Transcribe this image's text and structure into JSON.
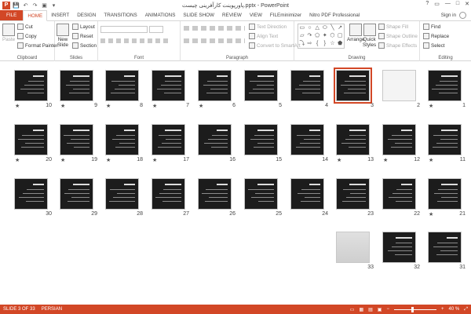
{
  "window": {
    "title": "پاورپوینت کارآفرینی چیست.pptx - PowerPoint",
    "app_icon": "P",
    "controls": {
      "help": "?",
      "restore": "▭",
      "minimize": "—",
      "maximize": "□",
      "close": "✕"
    }
  },
  "qat": {
    "save": "💾",
    "undo": "↶",
    "redo": "↷",
    "present": "▣",
    "customize": "▾"
  },
  "tabs": [
    {
      "label": "FILE"
    },
    {
      "label": "HOME"
    },
    {
      "label": "INSERT"
    },
    {
      "label": "DESIGN"
    },
    {
      "label": "TRANSITIONS"
    },
    {
      "label": "ANIMATIONS"
    },
    {
      "label": "SLIDE SHOW"
    },
    {
      "label": "REVIEW"
    },
    {
      "label": "VIEW"
    },
    {
      "label": "FILEminimizer"
    },
    {
      "label": "Nitro PDF Professional"
    }
  ],
  "account": {
    "signin": "Sign in"
  },
  "ribbon": {
    "clipboard": {
      "label": "Clipboard",
      "paste": "Paste",
      "cut": "Cut",
      "copy": "Copy",
      "format_painter": "Format Painter"
    },
    "slides": {
      "label": "Slides",
      "new_slide": "New",
      "new_slide2": "Slide",
      "layout": "Layout",
      "reset": "Reset",
      "section": "Section"
    },
    "font": {
      "label": "Font"
    },
    "paragraph": {
      "label": "Paragraph",
      "text_direction": "Text Direction",
      "align_text": "Align Text",
      "smartart": "Convert to SmartArt"
    },
    "drawing": {
      "label": "Drawing",
      "arrange": "Arrange",
      "quick_styles": "Quick",
      "quick_styles2": "Styles",
      "shape_fill": "Shape Fill",
      "shape_outline": "Shape Outline",
      "shape_effects": "Shape Effects"
    },
    "editing": {
      "label": "Editing",
      "find": "Find",
      "replace": "Replace",
      "select": "Select"
    },
    "shape_glyphs": [
      "▭",
      "○",
      "△",
      "⬭",
      "╲",
      "↗",
      "▱",
      "↷",
      "⬠",
      "✦",
      "⬡",
      "▢",
      "⤵",
      "⇨",
      "{",
      "}",
      "☆",
      "⬟"
    ]
  },
  "slides": [
    {
      "n": "10",
      "star": "★"
    },
    {
      "n": "9",
      "star": "★"
    },
    {
      "n": "8",
      "star": "★"
    },
    {
      "n": "7",
      "star": "★"
    },
    {
      "n": "6",
      "star": "★"
    },
    {
      "n": "5",
      "star": ""
    },
    {
      "n": "4",
      "star": ""
    },
    {
      "n": "3",
      "star": ""
    },
    {
      "n": "2",
      "star": ""
    },
    {
      "n": "1",
      "star": "★"
    },
    {
      "n": "20",
      "star": "★"
    },
    {
      "n": "19",
      "star": "★"
    },
    {
      "n": "18",
      "star": "★"
    },
    {
      "n": "17",
      "star": "★"
    },
    {
      "n": "16",
      "star": ""
    },
    {
      "n": "15",
      "star": ""
    },
    {
      "n": "14",
      "star": ""
    },
    {
      "n": "13",
      "star": "★"
    },
    {
      "n": "12",
      "star": "★"
    },
    {
      "n": "11",
      "star": "★"
    },
    {
      "n": "30",
      "star": ""
    },
    {
      "n": "29",
      "star": ""
    },
    {
      "n": "28",
      "star": ""
    },
    {
      "n": "27",
      "star": ""
    },
    {
      "n": "26",
      "star": ""
    },
    {
      "n": "25",
      "star": ""
    },
    {
      "n": "24",
      "star": ""
    },
    {
      "n": "23",
      "star": ""
    },
    {
      "n": "22",
      "star": ""
    },
    {
      "n": "21",
      "star": "★"
    },
    {
      "n": "33",
      "star": ""
    },
    {
      "n": "32",
      "star": ""
    },
    {
      "n": "31",
      "star": ""
    }
  ],
  "selected_slide": "3",
  "status": {
    "slide_of": "SLIDE 3 OF 33",
    "language": "PERSIAN",
    "zoom": "40 %",
    "zoom_level": 0.4
  },
  "colors": {
    "accent": "#d24726",
    "slide_bg": "#1c1c1c"
  }
}
